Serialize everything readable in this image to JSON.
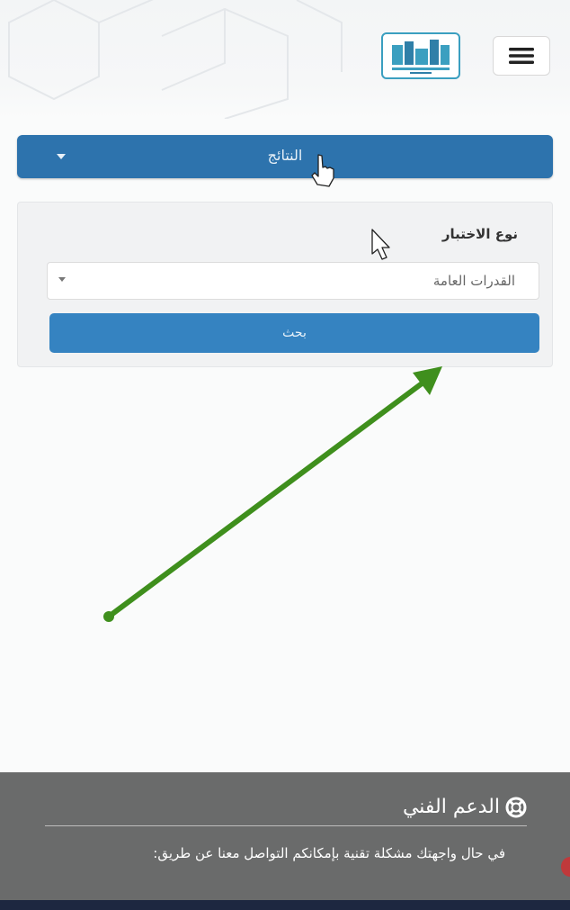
{
  "header": {
    "menu_icon": "hamburger-menu-icon",
    "logo_icon": "qiyas-logo-icon"
  },
  "results": {
    "label": "النتائج",
    "caret_icon": "caret-down-icon",
    "color": "#2d73ad"
  },
  "form": {
    "test_type_label": "نوع الاختبار",
    "test_type_selected": "القدرات العامة",
    "search_label": "بحث",
    "button_color": "#3583c1"
  },
  "annotation": {
    "arrow_color": "#3f8f1d",
    "arrow_icon": "green-arrow-icon"
  },
  "footer": {
    "title": "الدعم الفني",
    "title_icon": "life-ring-icon",
    "text": "في حال واجهتك مشكلة تقنية بإمكانكم التواصل معنا عن طريق:",
    "background": "#6a6b6b"
  }
}
